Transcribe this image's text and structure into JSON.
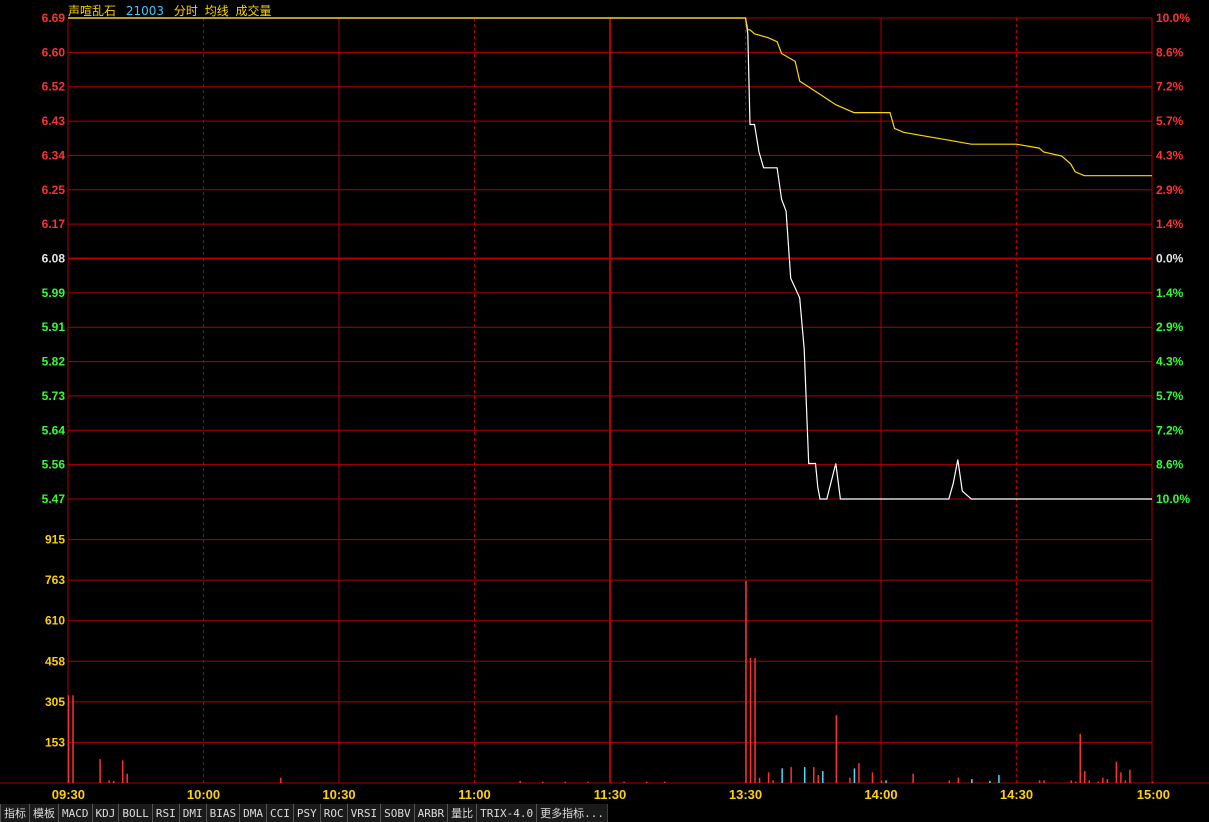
{
  "header": {
    "name": "声喧乱石",
    "code": "21003",
    "mode": "分时",
    "avg_label": "均线",
    "vol_label": "成交量"
  },
  "colors": {
    "grid": "#b00000",
    "up": "#ff3030",
    "down": "#30ff30",
    "neutral": "#e6e6e6",
    "volume_label": "#ffd200",
    "price_line": "#ffffff",
    "avg_line": "#ffd700",
    "vol_up": "#ff3030",
    "vol_down": "#40e0ff"
  },
  "chart_data": {
    "type": "line",
    "prev_close": 6.08,
    "price_ticks": [
      "6.69",
      "6.60",
      "6.52",
      "6.43",
      "6.34",
      "6.25",
      "6.17",
      "6.08",
      "5.99",
      "5.91",
      "5.82",
      "5.73",
      "5.64",
      "5.56",
      "5.47"
    ],
    "pct_ticks": [
      "10.0%",
      "8.6%",
      "7.2%",
      "5.7%",
      "4.3%",
      "2.9%",
      "1.4%",
      "0.0%",
      "1.4%",
      "2.9%",
      "4.3%",
      "5.7%",
      "7.2%",
      "8.6%",
      "10.0%"
    ],
    "volume_ticks": [
      "915",
      "763",
      "610",
      "458",
      "305",
      "153"
    ],
    "time_labels": [
      "09:30",
      "10:00",
      "10:30",
      "11:00",
      "11:30",
      "13:30",
      "14:00",
      "14:30",
      "15:00"
    ],
    "ylim": [
      5.47,
      6.69
    ],
    "vol_max": 1068,
    "total_minutes": 240,
    "series": [
      {
        "name": "price",
        "x": [
          0,
          150,
          150.5,
          151,
          152,
          153,
          154,
          155,
          157,
          158,
          159,
          160,
          162,
          163,
          164,
          165,
          165.5,
          166,
          166.5,
          167,
          168,
          170,
          171,
          172,
          175,
          175.5,
          176,
          180,
          185,
          190,
          195,
          196,
          197,
          198,
          199,
          200,
          240
        ],
        "values": [
          6.69,
          6.69,
          6.65,
          6.42,
          6.42,
          6.35,
          6.31,
          6.31,
          6.31,
          6.23,
          6.2,
          6.03,
          5.98,
          5.85,
          5.56,
          5.56,
          5.56,
          5.5,
          5.47,
          5.47,
          5.47,
          5.56,
          5.47,
          5.47,
          5.47,
          5.47,
          5.47,
          5.47,
          5.47,
          5.47,
          5.47,
          5.51,
          5.57,
          5.49,
          5.48,
          5.47,
          5.47
        ]
      },
      {
        "name": "avg",
        "x": [
          0,
          150,
          150.5,
          151,
          152,
          155,
          157,
          158,
          161,
          162,
          166,
          170,
          172,
          174,
          175,
          179,
          182,
          183,
          185,
          190,
          195,
          200,
          210,
          215,
          216,
          220,
          222,
          223,
          225,
          230,
          240
        ],
        "values": [
          6.69,
          6.69,
          6.66,
          6.66,
          6.65,
          6.64,
          6.63,
          6.6,
          6.58,
          6.53,
          6.5,
          6.47,
          6.46,
          6.45,
          6.45,
          6.45,
          6.45,
          6.41,
          6.4,
          6.39,
          6.38,
          6.37,
          6.37,
          6.36,
          6.35,
          6.34,
          6.32,
          6.3,
          6.29,
          6.29,
          6.29
        ]
      }
    ],
    "volume": {
      "up": {
        "x": [
          0,
          1,
          7,
          9,
          10,
          12,
          13,
          47,
          100,
          105,
          110,
          115,
          123,
          128,
          132,
          150,
          151,
          152,
          153,
          155,
          156,
          160,
          165,
          166,
          170,
          173,
          175,
          178,
          180,
          187,
          195,
          197,
          200,
          215,
          216,
          222,
          223,
          224,
          225,
          226,
          228,
          229,
          230,
          232,
          233,
          234,
          235,
          240
        ],
        "values": [
          330,
          330,
          90,
          10,
          8,
          85,
          35,
          20,
          8,
          5,
          5,
          5,
          5,
          5,
          5,
          760,
          470,
          470,
          20,
          40,
          10,
          60,
          60,
          30,
          255,
          20,
          75,
          40,
          10,
          35,
          10,
          20,
          10,
          10,
          10,
          10,
          5,
          185,
          45,
          10,
          5,
          20,
          15,
          80,
          40,
          10,
          50,
          5
        ]
      },
      "down": {
        "x": [
          158,
          163,
          167,
          174,
          181,
          200,
          204,
          206
        ],
        "values": [
          55,
          60,
          45,
          55,
          10,
          15,
          8,
          30
        ]
      }
    }
  },
  "tabs": [
    "指标",
    "模板",
    "MACD",
    "KDJ",
    "BOLL",
    "RSI",
    "DMI",
    "BIAS",
    "DMA",
    "CCI",
    "PSY",
    "ROC",
    "VRSI",
    "SOBV",
    "ARBR",
    "量比",
    "TRIX-4.0",
    "更多指标..."
  ]
}
